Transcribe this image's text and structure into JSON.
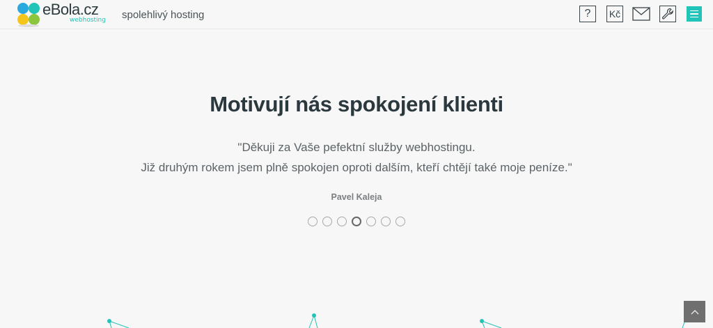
{
  "brand": {
    "name": "eBola.cz",
    "sub": "webhosting",
    "tagline": "spolehlivý hosting",
    "colors": {
      "accent": "#22c3b8",
      "green": "#8cc63e",
      "yellow": "#f4c51a",
      "blue": "#2aa9df"
    }
  },
  "header": {
    "buttons": [
      {
        "icon": "question-icon",
        "glyph": "?"
      },
      {
        "icon": "price-icon",
        "glyph": "Kč"
      },
      {
        "icon": "mail-icon"
      },
      {
        "icon": "wrench-icon"
      },
      {
        "icon": "menu-icon"
      }
    ]
  },
  "testimonial": {
    "title": "Motivují nás spokojení klienti",
    "quote_line1": "\"Děkuji za Vaše pefektní služby webhostingu.",
    "quote_line2": "Již druhým rokem jsem plně spokojen oproti dalším, kteří chtějí také moje peníze.\"",
    "author": "Pavel Kaleja",
    "slides_total": 7,
    "active_slide": 4
  },
  "scroll_top": {
    "icon": "chevron-up-icon"
  }
}
